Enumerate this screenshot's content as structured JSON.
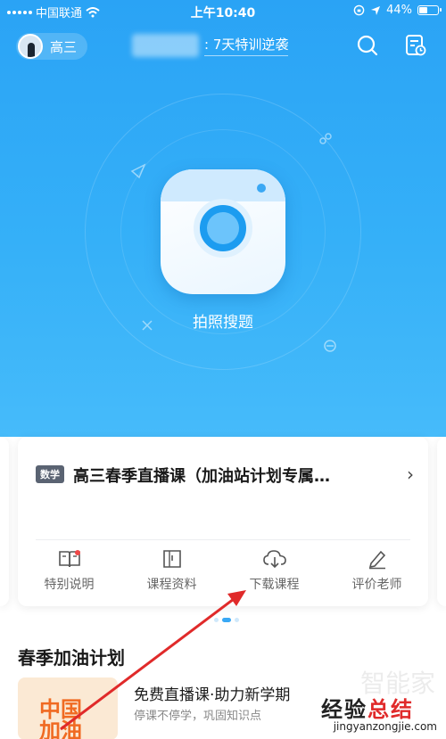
{
  "status_bar": {
    "carrier": "中国联通",
    "time": "上午10:40",
    "battery": "44%"
  },
  "header": {
    "grade": "高三",
    "promo_text": ": 7天特训逆袭"
  },
  "camera": {
    "label": "拍照搜题"
  },
  "course_card": {
    "tag": "数学",
    "title": "高三春季直播课（加油站计划专属…",
    "actions": [
      {
        "label": "特别说明",
        "icon": "book-icon"
      },
      {
        "label": "课程资料",
        "icon": "document-icon"
      },
      {
        "label": "下载课程",
        "icon": "cloud-download-icon"
      },
      {
        "label": "评价老师",
        "icon": "pencil-icon"
      }
    ]
  },
  "section": {
    "title": "春季加油计划",
    "promo": {
      "thumb_text": "中国\n加油",
      "title": "免费直播课·助力新学期",
      "subtitle": "停课不停学，巩固知识点"
    }
  },
  "watermark": {
    "faint": "智能家",
    "main_a": "经验",
    "main_b": "总结",
    "url": "jingyanzongjie.com"
  },
  "colors": {
    "hero": "#2aa3f5",
    "accent": "#39a8f5",
    "annotation_arrow": "#e02a2a"
  }
}
